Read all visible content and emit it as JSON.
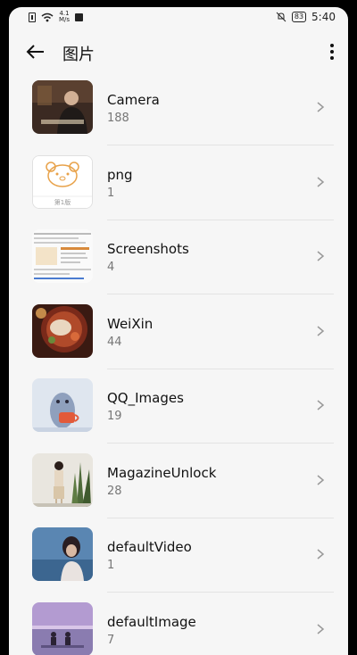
{
  "status_bar": {
    "network_speed_top": "4.1",
    "network_speed_unit": "M/s",
    "battery_level": "83",
    "time": "5:40"
  },
  "app_bar": {
    "back_icon": "arrow-left-icon",
    "title": "图片",
    "more_icon": "more-vertical-icon"
  },
  "albums": [
    {
      "name": "Camera",
      "count": "188"
    },
    {
      "name": "png",
      "count": "1",
      "thumb_caption": "第1版"
    },
    {
      "name": "Screenshots",
      "count": "4"
    },
    {
      "name": "WeiXin",
      "count": "44"
    },
    {
      "name": "QQ_Images",
      "count": "19"
    },
    {
      "name": "MagazineUnlock",
      "count": "28"
    },
    {
      "name": "defaultVideo",
      "count": "1"
    },
    {
      "name": "defaultImage",
      "count": "7"
    }
  ],
  "colors": {
    "background": "#f6f6f6",
    "divider": "#e3e3e3",
    "secondary_text": "#777777"
  }
}
